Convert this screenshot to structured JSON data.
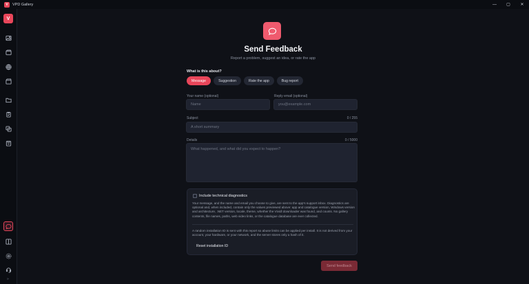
{
  "window": {
    "app_logo_letter": "V",
    "title": "VPD Gallery",
    "controls": {
      "minimize": "—",
      "maximize": "▢",
      "close": "✕"
    }
  },
  "sidebar": {
    "avatar_letter": "V",
    "items": [
      {
        "icon": "gallery-icon"
      },
      {
        "icon": "video-icon"
      },
      {
        "icon": "globe-icon"
      },
      {
        "icon": "clapper-icon"
      },
      {
        "icon": "folder-icon"
      },
      {
        "icon": "clipboard-icon"
      },
      {
        "icon": "copy-icon"
      },
      {
        "icon": "archive-icon"
      },
      {
        "icon": "feedback-icon",
        "active": true
      },
      {
        "icon": "panel-icon"
      },
      {
        "icon": "settings-icon"
      },
      {
        "icon": "support-icon"
      }
    ],
    "collapse_glyph": "»"
  },
  "header": {
    "title": "Send Feedback",
    "subtitle": "Report a problem, suggest an idea, or rate the app"
  },
  "topic": {
    "label": "What is this about?",
    "options": [
      "Message",
      "Suggestion",
      "Rate the app",
      "Bug report"
    ],
    "selected": "Message"
  },
  "form": {
    "name_label": "Your name (optional)",
    "name_placeholder": "Name",
    "email_label": "Reply email (optional)",
    "email_placeholder": "you@example.com",
    "subject_label": "Subject",
    "subject_counter": "0 / 255",
    "subject_placeholder": "A short summary",
    "details_label": "Details",
    "details_counter": "0 / 5000",
    "details_placeholder": "What happened, and what did you expect to happen?"
  },
  "diagnostics": {
    "checkbox_label": "Include technical diagnostics",
    "checked": false,
    "description": "Your message, and the name and email you choose to give, are sent to the app's support inbox. Diagnostics are optional and, when included, contain only the values previewed above: app and catalogue version, Windows version and architecture, .NET version, locale, theme, whether the Vividl downloader was found, and counts. No gallery contents, file names, paths, web video links, or the catalogue database are ever collected.",
    "installation_note": "A random installation ID is sent with this report so abuse limits can be applied per install. It is not derived from your account, your hardware, or your network, and the server stores only a hash of it.",
    "reset_label": "Reset installation ID"
  },
  "actions": {
    "send_label": "Send feedback"
  },
  "colors": {
    "accent": "#e8465a",
    "background": "#0f1117",
    "surface": "#1f2330",
    "send_disabled": "#7a2a35"
  }
}
